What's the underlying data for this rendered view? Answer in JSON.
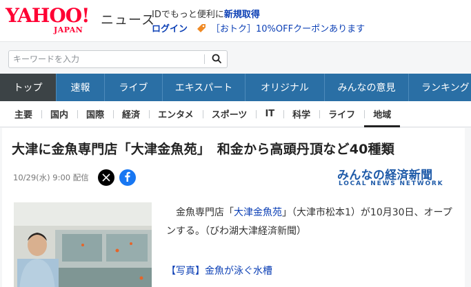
{
  "header": {
    "logo_main": "YAHOO!",
    "logo_sub": "JAPAN",
    "section_label": "ニュース",
    "promo_line1_text": "IDでもっと便利に",
    "promo_line1_link": "新規取得",
    "login_label": "ログイン",
    "coupon_text": "［おトク］10%OFFクーポンあります",
    "brand_color": "#ff0033"
  },
  "search": {
    "placeholder": "キーワードを入力",
    "button_icon": "search-icon"
  },
  "primary_nav": {
    "items": [
      "トップ",
      "速報",
      "ライブ",
      "エキスパート",
      "オリジナル",
      "みんなの意見",
      "ランキング"
    ],
    "active": "トップ"
  },
  "secondary_nav": {
    "items": [
      "主要",
      "国内",
      "国際",
      "経済",
      "エンタメ",
      "スポーツ",
      "IT",
      "科学",
      "ライフ",
      "地域"
    ],
    "active": "地域"
  },
  "article": {
    "headline": "大津に金魚専門店「大津金魚苑」　和金から高頭丹頂など40種類",
    "date": "10/29(水) 9:00",
    "date_suffix": "配信",
    "source_name": "みんなの経済新聞",
    "source_sub": "LOCAL NEWS NETWORK",
    "body_lead": "金魚専門店「",
    "body_link": "大津金魚苑",
    "body_rest": "」（大津市松本1）が10月30日、オープンする。（びわ湖大津経済新聞）",
    "photo_link": "【写真】金魚が泳ぐ水槽"
  }
}
